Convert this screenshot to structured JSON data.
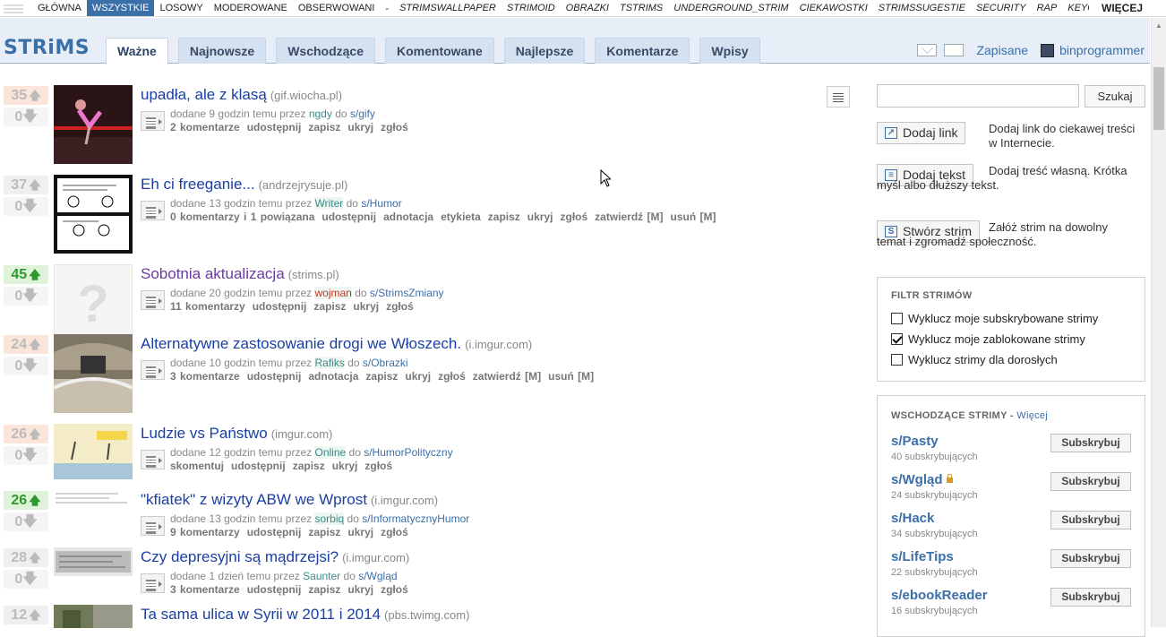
{
  "topnav": {
    "items": [
      "GŁÓWNA",
      "WSZYSTKIE",
      "LOSOWY",
      "MODEROWANE",
      "OBSERWOWANI"
    ],
    "separator": "-",
    "strims": [
      "STRIMSWALLPAPER",
      "STRIMOID",
      "OBRAZKI",
      "TSTRIMS",
      "UNDERGROUND_STRIM",
      "CIEKAWOSTKI",
      "STRIMSSUGESTIE",
      "SECURITY",
      "RAP",
      "KEYGENS"
    ],
    "more": "WIĘCEJ"
  },
  "header": {
    "logo": "STRiMS",
    "tabs": [
      "Ważne",
      "Najnowsze",
      "Wschodzące",
      "Komentowane",
      "Najlepsze",
      "Komentarze",
      "Wpisy"
    ],
    "saved": "Zapisane",
    "username": "binprogrammer"
  },
  "posts": [
    {
      "score": "35",
      "down": "0",
      "title": "upadła, ale z klasą",
      "domain": "(gif.wiocha.pl)",
      "age": "9 godzin",
      "user": "ngdy",
      "sub": "s/gify",
      "actions": [
        "2 komentarze",
        "udostępnij",
        "zapisz",
        "ukryj",
        "zgłoś"
      ]
    },
    {
      "score": "37",
      "down": "0",
      "title": "Eh ci freeganie...",
      "domain": "(andrzejrysuje.pl)",
      "age": "13 godzin",
      "user": "Writer",
      "sub": "s/Humor",
      "actions": [
        "0 komentarzy i 1 powiązana",
        "udostępnij",
        "adnotacja",
        "etykieta",
        "zapisz",
        "ukryj",
        "zgłoś",
        "zatwierdź [M]",
        "usuń [M]"
      ]
    },
    {
      "score": "45",
      "down": "0",
      "title": "Sobotnia aktualizacja",
      "domain": "(strims.pl)",
      "age": "20 godzin",
      "user": "wojman",
      "sub": "s/StrimsZmiany",
      "actions": [
        "11 komentarzy",
        "udostępnij",
        "zapisz",
        "ukryj",
        "zgłoś"
      ]
    },
    {
      "score": "24",
      "down": "0",
      "title": "Alternatywne zastosowanie drogi we Włoszech.",
      "domain": "(i.imgur.com)",
      "age": "10 godzin",
      "user": "Rafiks",
      "sub": "s/Obrazki",
      "actions": [
        "3 komentarze",
        "udostępnij",
        "adnotacja",
        "zapisz",
        "ukryj",
        "zgłoś",
        "zatwierdź [M]",
        "usuń [M]"
      ]
    },
    {
      "score": "26",
      "down": "0",
      "title": "Ludzie vs Państwo",
      "domain": "(imgur.com)",
      "age": "12 godzin",
      "user": "Online",
      "sub": "s/HumorPolityczny",
      "actions": [
        "skomentuj",
        "udostępnij",
        "zapisz",
        "ukryj",
        "zgłoś"
      ]
    },
    {
      "score": "26",
      "down": "0",
      "title": "\"kfiatek\" z wizyty ABW we Wprost",
      "domain": "(i.imgur.com)",
      "age": "13 godzin",
      "user": "sorbiq",
      "sub": "s/InformatycznyHumor",
      "actions": [
        "9 komentarzy",
        "udostępnij",
        "zapisz",
        "ukryj",
        "zgłoś"
      ]
    },
    {
      "score": "28",
      "down": "0",
      "title": "Czy depresyjni są mądrzejsi?",
      "domain": "(i.imgur.com)",
      "age": "1 dzień",
      "user": "Saunter",
      "sub": "s/Wgląd",
      "actions": [
        "3 komentarze",
        "udostępnij",
        "zapisz",
        "ukryj",
        "zgłoś"
      ]
    },
    {
      "score": "12",
      "down": "0",
      "title": "Ta sama ulica w Syrii w 2011 i 2014",
      "domain": "(pbs.twimg.com)"
    }
  ],
  "meta_words": {
    "added": "dodane",
    "ago": "temu przez",
    "to": "do"
  },
  "sidebar": {
    "search_button": "Szukaj",
    "add_link": "Dodaj link",
    "add_link_desc": "Dodaj link do ciekawej treści w Internecie.",
    "add_text": "Dodaj tekst",
    "add_text_desc": "Dodaj treść własną. Krótka myśl albo dłuższy tekst.",
    "create_strim": "Stwórz strim",
    "create_strim_desc": "Załóż strim na dowolny temat i zgromadź społeczność.",
    "filter_title": "FILTR STRIMÓW",
    "filters": [
      {
        "label": "Wyklucz moje subskrybowane strimy",
        "checked": false
      },
      {
        "label": "Wyklucz moje zablokowane strimy",
        "checked": true
      },
      {
        "label": "Wyklucz strimy dla dorosłych",
        "checked": false
      }
    ],
    "rising_title": "WSCHODZĄCE STRIMY",
    "rising_more": "Więcej",
    "rising": [
      {
        "name": "s/Pasty",
        "count": "40 subskrybujących"
      },
      {
        "name": "s/Wgląd",
        "count": "24 subskrybujących"
      },
      {
        "name": "s/Hack",
        "count": "34 subskrybujących"
      },
      {
        "name": "s/LifeTips",
        "count": "22 subskrybujących"
      },
      {
        "name": "s/ebookReader",
        "count": "16 subskrybujących"
      }
    ],
    "subscribe": "Subskrybuj"
  }
}
